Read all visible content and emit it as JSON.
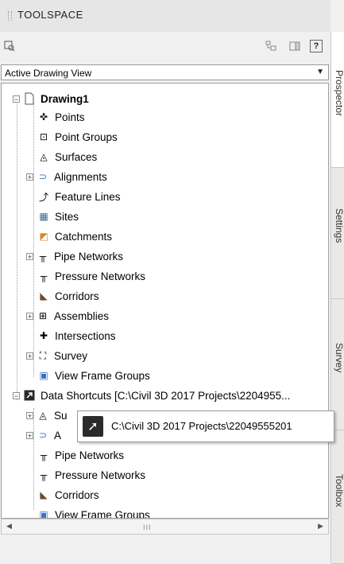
{
  "panel": {
    "title": "TOOLSPACE"
  },
  "toolbar": {
    "view_select_icon": "view-select-icon",
    "item_view_icon": "item-view-icon",
    "toggle_icon": "toggle-icon",
    "help_label": "?"
  },
  "dropdown": {
    "value": "Active Drawing View"
  },
  "tree": {
    "drawing": "Drawing1",
    "items": [
      "Points",
      "Point Groups",
      "Surfaces",
      "Alignments",
      "Feature Lines",
      "Sites",
      "Catchments",
      "Pipe Networks",
      "Pressure Networks",
      "Corridors",
      "Assemblies",
      "Intersections",
      "Survey",
      "View Frame Groups"
    ],
    "shortcuts": "Data Shortcuts [C:\\Civil 3D 2017 Projects\\2204955...",
    "shortcut_items": [
      "Su",
      "A",
      "Pipe Networks",
      "Pressure Networks",
      "Corridors",
      "View Frame Groups"
    ]
  },
  "tooltip": {
    "text": "C:\\Civil 3D 2017 Projects\\22049555201"
  },
  "scrollbar": {
    "left": "◀",
    "right": "▶",
    "thumb": "III"
  },
  "tabs": [
    "Prospector",
    "Settings",
    "Survey",
    "Toolbox"
  ]
}
